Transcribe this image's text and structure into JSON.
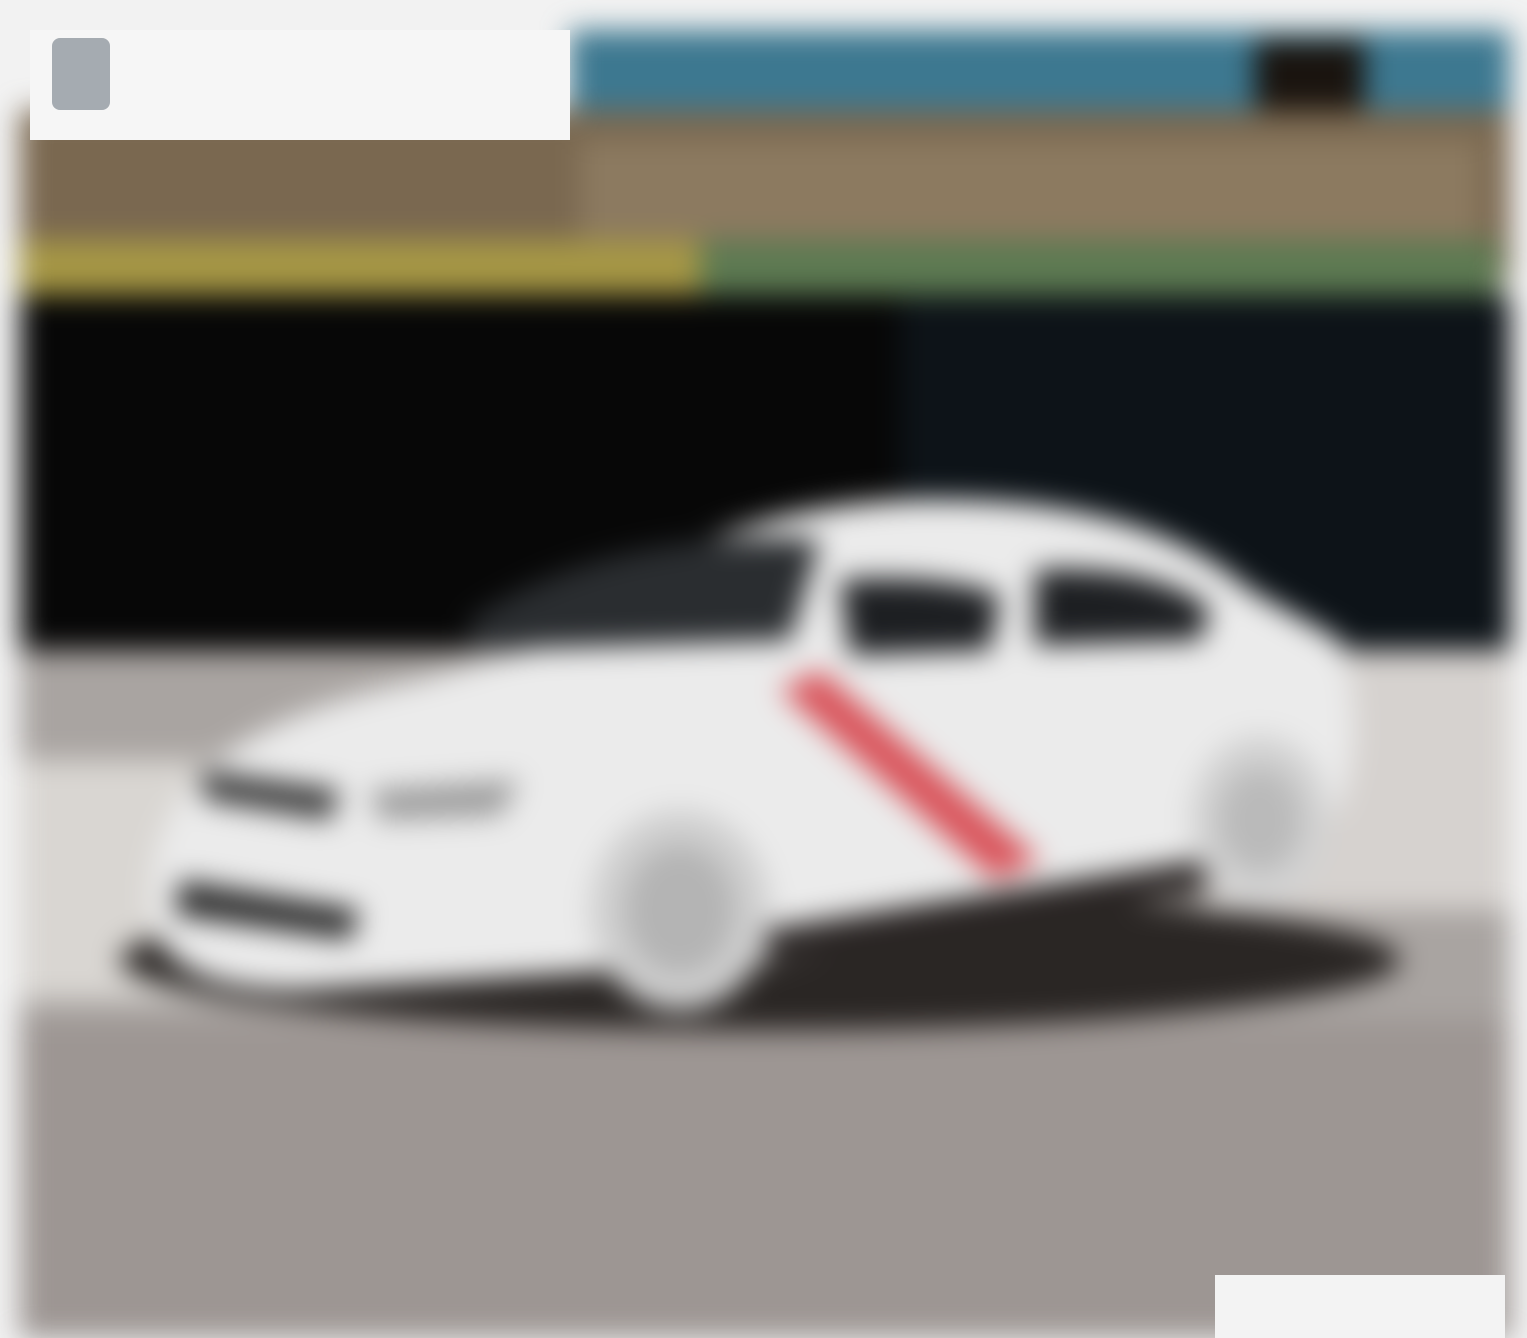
{
  "image": {
    "subject": "white sedan",
    "palette": {
      "background": "#f2f2f2",
      "sky": "#3d7890",
      "building": "#7a6850",
      "tunnel": "#070707",
      "car_body": "#ebebeb",
      "road": "#a9a4a1",
      "stripe": "#d9535a",
      "logo_red": "#e0203a"
    }
  },
  "logo": {
    "wordmark": ""
  },
  "caption": {
    "text": ""
  }
}
